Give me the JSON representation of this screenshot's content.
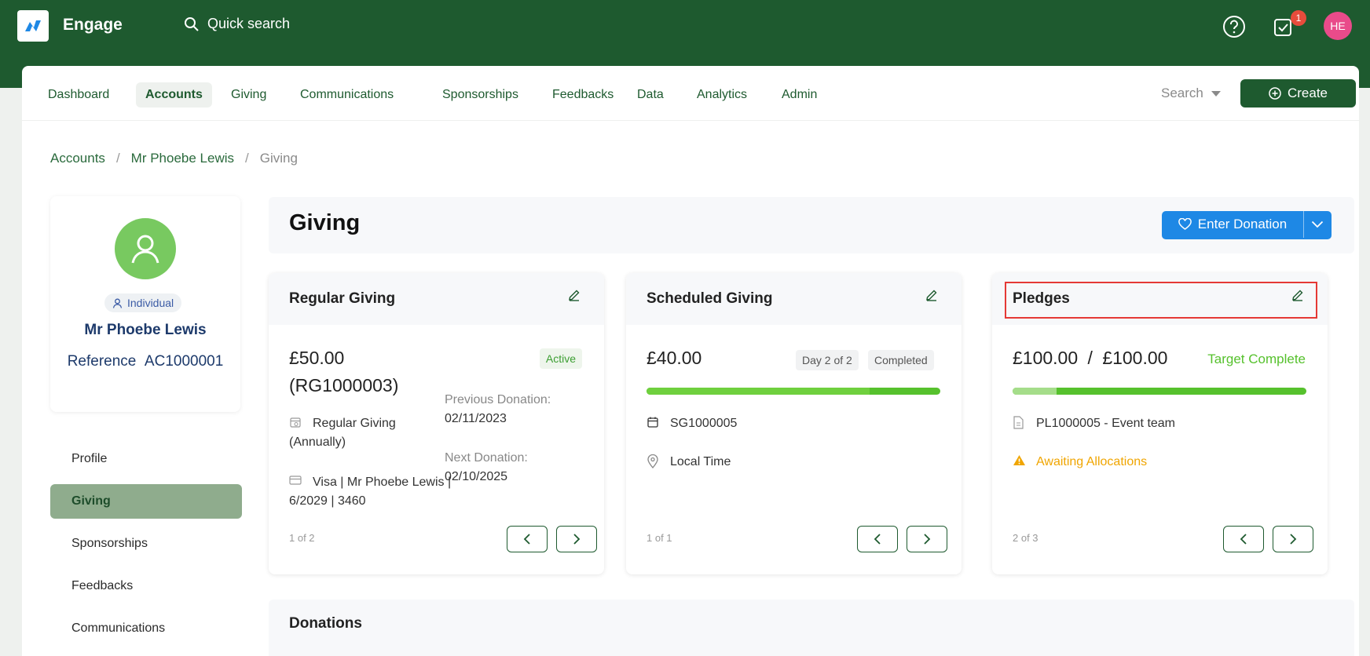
{
  "app": {
    "brand": "Engage",
    "quick_search": "Quick search",
    "notification_count": "1",
    "user_initials": "HE"
  },
  "nav": {
    "items": [
      "Dashboard",
      "Accounts",
      "Giving",
      "Communications",
      "Sponsorships",
      "Feedbacks",
      "Data",
      "Analytics",
      "Admin"
    ],
    "search_label": "Search",
    "create_label": "Create"
  },
  "breadcrumb": [
    "Accounts",
    "Mr Phoebe Lewis",
    "Giving"
  ],
  "profile": {
    "type": "Individual",
    "name": "Mr Phoebe Lewis",
    "reference_label": "Reference",
    "reference": "AC1000001"
  },
  "sidebar": [
    "Profile",
    "Giving",
    "Sponsorships",
    "Feedbacks",
    "Communications"
  ],
  "page": {
    "title": "Giving",
    "enter_donation": "Enter Donation"
  },
  "regular_giving": {
    "title": "Regular Giving",
    "amount": "£50.00",
    "ref": "(RG1000003)",
    "status": "Active",
    "frequency_line1": "Regular Giving",
    "frequency_line2": "(Annually)",
    "card_line1": "Visa | Mr Phoebe Lewis |",
    "card_line2": "6/2029 | 3460",
    "previous_label": "Previous Donation:",
    "previous_date": "02/11/2023",
    "next_label": "Next Donation:",
    "next_date": "02/10/2025",
    "pager": "1 of 2"
  },
  "scheduled_giving": {
    "title": "Scheduled Giving",
    "amount": "£40.00",
    "day": "Day 2 of 2",
    "status": "Completed",
    "progress": 1.0,
    "ref": "SG1000005",
    "time": "Local Time",
    "pager": "1 of 1"
  },
  "pledges": {
    "title": "Pledges",
    "amount": "£100.00",
    "separator": "/",
    "target": "£100.00",
    "status": "Target Complete",
    "progress": 1.0,
    "ref": "PL1000005 - Event team",
    "warning": "Awaiting Allocations",
    "pager": "2 of 3"
  },
  "donations": {
    "title": "Donations"
  },
  "colors": {
    "brand": "#1e5a2f",
    "accent_blue": "#1e88e5",
    "success": "#56c12d",
    "warning": "#f0a500",
    "highlight": "#e53935"
  }
}
